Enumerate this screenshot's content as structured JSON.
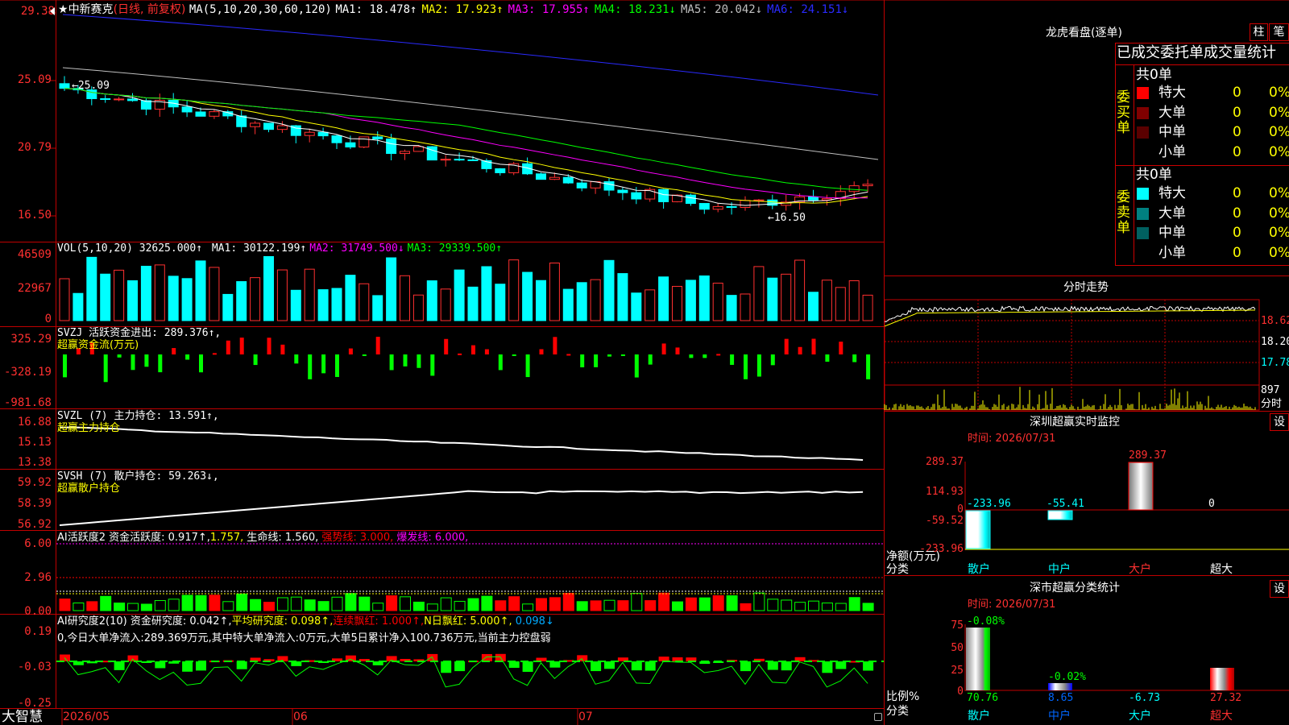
{
  "stock": {
    "star": "★",
    "name": "中新赛克",
    "mode": "(日线, 前复权)"
  },
  "main_chart": {
    "ma_label": "MA(5,10,20,30,60,120)",
    "ma": [
      {
        "name": "MA1:",
        "value": "18.478↑",
        "color": "#ffffff"
      },
      {
        "name": "MA2:",
        "value": "17.923↑",
        "color": "#ffff00"
      },
      {
        "name": "MA3:",
        "value": "17.955↑",
        "color": "#ff00ff"
      },
      {
        "name": "MA4:",
        "value": "18.231↓",
        "color": "#00ff00"
      },
      {
        "name": "MA5:",
        "value": "20.042↓",
        "color": "#c0c0c0"
      },
      {
        "name": "MA6:",
        "value": "24.151↓",
        "color": "#2a2aff"
      }
    ],
    "y_ticks": [
      "29.38",
      "25.09",
      "20.79",
      "16.50"
    ],
    "annotation_high": "25.09",
    "annotation_low": "16.50"
  },
  "volume": {
    "label": "VOL(5,10,20)",
    "value": "32625.000↑",
    "ma": [
      {
        "text": "MA1: 30122.199↑",
        "color": "#ffffff"
      },
      {
        "text": "MA2: 31749.500↓",
        "color": "#ff00ff"
      },
      {
        "text": "MA3: 29339.500↑",
        "color": "#00ff00"
      }
    ],
    "y_ticks": [
      "46509",
      "22967",
      "0"
    ]
  },
  "svzj": {
    "label": "SVZJ  活跃资金进出: 289.376↑,",
    "sub": "超赢资金流(万元)",
    "y_ticks": [
      "325.29",
      "-328.19",
      "-981.68"
    ]
  },
  "svzl": {
    "label": "SVZL (7) 主力持仓: 13.591↑,",
    "sub": "超赢主力持仓",
    "y_ticks": [
      "16.88",
      "15.13",
      "13.38"
    ]
  },
  "svsh": {
    "label": "SVSH (7) 散户持仓: 59.263↓,",
    "sub": "超赢散户持仓",
    "y_ticks": [
      "59.92",
      "58.39",
      "56.92"
    ]
  },
  "ai_activity": {
    "label": "AI活跃度2 资金活跃度: 0.917↑,",
    "v2": "1.757,",
    "v3": "生命线: 1.560,",
    "v4": "强势线: 3.000,",
    "v5": "爆发线: 6.000,",
    "y_ticks": [
      "6.00",
      "2.96",
      "0.00"
    ]
  },
  "ai_research": {
    "label": "AI研究度2(10) 资金研究度: 0.042↑,",
    "v2": "平均研究度: 0.098↑,",
    "v3": "连续飘红: 1.000↑,",
    "v4": "N日飘红: 5.000↑,",
    "v5": "0.098↓",
    "summary": "0,今日大单净流入:289.369万元,其中特大单净流入:0万元,大单5日累计净入100.736万元,当前主力控盘弱",
    "y_ticks": [
      "0.19",
      "-0.03",
      "-0.25"
    ]
  },
  "bottom_bar": {
    "brand": "大智慧",
    "dates": [
      "2026/05",
      "06",
      "07"
    ]
  },
  "right_panel": {
    "dragon_tiger": {
      "title": "龙虎看盘(逐单)",
      "btn_col": "柱",
      "btn_line": "笔",
      "header": "已成交委托单成交量统计"
    },
    "buy": {
      "side": "委买单",
      "total": "共0单",
      "rows": [
        {
          "label": "特大",
          "count": "0",
          "pct": "0%",
          "color": "#ff0000"
        },
        {
          "label": "大单",
          "count": "0",
          "pct": "0%",
          "color": "#800000"
        },
        {
          "label": "中单",
          "count": "0",
          "pct": "0%",
          "color": "#5a0000"
        },
        {
          "label": "小单",
          "count": "0",
          "pct": "0%",
          "color": ""
        }
      ]
    },
    "sell": {
      "side": "委卖单",
      "total": "共0单",
      "rows": [
        {
          "label": "特大",
          "count": "0",
          "pct": "0%",
          "color": "#00ffff"
        },
        {
          "label": "大单",
          "count": "0",
          "pct": "0%",
          "color": "#008080"
        },
        {
          "label": "中单",
          "count": "0",
          "pct": "0%",
          "color": "#006060"
        },
        {
          "label": "小单",
          "count": "0",
          "pct": "0%",
          "color": ""
        }
      ]
    },
    "intraday": {
      "title": "分时走势",
      "prices": [
        "18.62",
        "18.20",
        "17.78"
      ],
      "volume": "897",
      "vol_label": "分时"
    },
    "realtime": {
      "title": "深圳超赢实时监控",
      "set": "设",
      "time": "时间: 2026/07/31",
      "y_ticks": [
        "289.37",
        "114.93",
        "0",
        "-59.52",
        "-233.96"
      ],
      "y_title": "净额(万元)",
      "x_title": "分类",
      "values": [
        "-233.96",
        "-55.41",
        "289.37",
        "0"
      ],
      "categories": [
        "散户",
        "中户",
        "大户",
        "超大"
      ]
    },
    "classify": {
      "title": "深市超赢分类统计",
      "set": "设",
      "time": "时间: 2026/07/31",
      "y_ticks": [
        "75",
        "50",
        "25",
        "0"
      ],
      "y_title": "比例%",
      "x_title": "分类",
      "top_values": [
        "-0.08%",
        "-0.02%"
      ],
      "values": [
        "70.76",
        "8.65",
        "-6.73",
        "27.32"
      ],
      "categories": [
        "散户",
        "中户",
        "大户",
        "超大"
      ]
    }
  }
}
